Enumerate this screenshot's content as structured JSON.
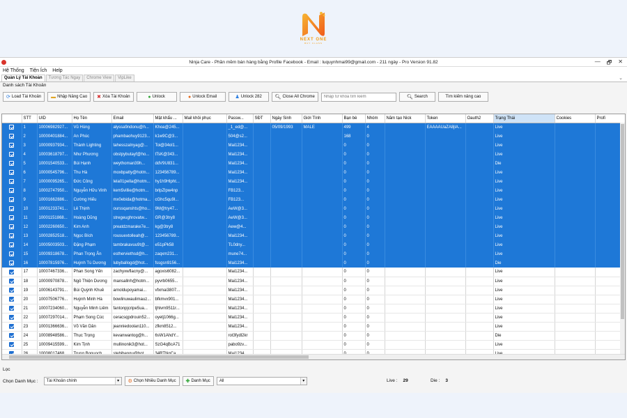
{
  "logo": {
    "brand": "NEXT ONE",
    "tagline": "BUY CLASS",
    "accent": "#f39c12"
  },
  "window": {
    "title": "Ninja Care - Phần mềm bán hàng bằng Profile Facebook - Email : luquynhmai99@gmail.com - 211 ngày - Pro Version 91.82",
    "controls": [
      "—",
      "🗗",
      "✕"
    ]
  },
  "menu": [
    "Hệ Thống",
    "Tiện Ích",
    "Help"
  ],
  "tabs": [
    "Quản Lý Tài Khoản",
    "Tương Tác Ngay",
    "Chrome View",
    "VipLike"
  ],
  "section_label": "Danh sách Tài Khoản",
  "toolbar": {
    "load": "Load Tài Khoản",
    "import": "Nhập Nâng Cao",
    "delete": "Xóa Tài Khoản",
    "unlock": "Unlock",
    "unlock_email": "Unlock Email",
    "unlock282": "Unlock 282",
    "close_chrome": "Close All Chrome",
    "search_placeholder": "Nhập từ khóa tìm kiếm",
    "search": "Search",
    "advanced_search": "Tìm kiếm nâng cao"
  },
  "columns": [
    "",
    "STT",
    "UID",
    "Họ Tên",
    "Email",
    "Mật khẩu ...",
    "Mail khôi phục",
    "Passw...",
    "SĐT",
    "Ngày Sinh",
    "Giới Tính",
    "Bạn bè",
    "Nhóm",
    "Năm tạo Nick",
    "Token",
    "Oauth2",
    "Trạng Thái",
    "Cookies",
    "Profi"
  ],
  "rows": [
    {
      "sel": true,
      "c": [
        "1",
        "10006982927...",
        "Vũ Hùng",
        "alyssa9ndonu@h...",
        "Khoa@245...",
        "",
        "_1_ed@...",
        "",
        "05/09/1993",
        "MALE",
        "499",
        "4",
        "",
        "EAAAAUaZA8jlA...",
        "",
        "Live",
        "",
        ""
      ]
    },
    {
      "sel": true,
      "c": [
        "2",
        "10000401884...",
        "An Phúc",
        "phambaohuy9123...",
        "k1w9C@3...",
        "",
        "504@s2...",
        "",
        "",
        "",
        "168",
        "0",
        "",
        "",
        "",
        "Live",
        "",
        ""
      ]
    },
    {
      "sel": true,
      "c": [
        "3",
        "10000937934...",
        "Thành Lighting",
        "tahesszalnyag@...",
        "Toi@34ol1...",
        "",
        "Mai1234...",
        "",
        "",
        "",
        "0",
        "0",
        "",
        "",
        "",
        "Live",
        "",
        ""
      ]
    },
    {
      "sel": true,
      "c": [
        "4",
        "10003618797...",
        "Như Phương",
        "obstpybutayf@ho...",
        "tTsK@343...",
        "",
        "Mai1234...",
        "",
        "",
        "",
        "0",
        "0",
        "",
        "",
        "",
        "Live",
        "",
        ""
      ]
    },
    {
      "sel": true,
      "c": [
        "5",
        "10001540533...",
        "Bùi Hạnh",
        "weythoman39h...",
        "ddV9U831...",
        "",
        "Mai1234...",
        "",
        "",
        "",
        "0",
        "0",
        "",
        "",
        "",
        "Die",
        "",
        ""
      ]
    },
    {
      "sel": true,
      "c": [
        "6",
        "10000545796...",
        "Thu Hà",
        "moxbpatty@hotm...",
        "123456789...",
        "",
        "Mai1234...",
        "",
        "",
        "",
        "0",
        "0",
        "",
        "",
        "",
        "Live",
        "",
        ""
      ]
    },
    {
      "sel": true,
      "c": [
        "7",
        "10000095265...",
        "Đức Công",
        "lela01pella@hotm...",
        "hy1h9Hlpht...",
        "",
        "Mai1234...",
        "",
        "",
        "",
        "0",
        "0",
        "",
        "",
        "",
        "Live",
        "",
        ""
      ]
    },
    {
      "sel": true,
      "c": [
        "8",
        "10002747950...",
        "Nguyễn Hữu Vinh",
        "kem5villie@hotm...",
        "brlpZlpw4np",
        "",
        "FB123...",
        "",
        "",
        "",
        "0",
        "0",
        "",
        "",
        "",
        "Live",
        "",
        ""
      ]
    },
    {
      "sel": true,
      "c": [
        "9",
        "10001662886...",
        "Cường Hiếu",
        "mx0ebida@hotma...",
        "cGhc5qu9l...",
        "",
        "FB123...",
        "",
        "",
        "",
        "0",
        "0",
        "",
        "",
        "",
        "Live",
        "",
        ""
      ]
    },
    {
      "sel": true,
      "c": [
        "10",
        "10001233741...",
        "Lê Thịnh",
        "ourssqanshts@ho...",
        "9M@try47...",
        "",
        "AeW@3...",
        "",
        "",
        "",
        "0",
        "0",
        "",
        "",
        "",
        "Live",
        "",
        ""
      ]
    },
    {
      "sel": true,
      "c": [
        "11",
        "10001151868...",
        "Hoàng Dũng",
        "stregeughrovatw...",
        "GR@3try8",
        "",
        "AeW@3...",
        "",
        "",
        "",
        "0",
        "0",
        "",
        "",
        "",
        "Live",
        "",
        ""
      ]
    },
    {
      "sel": true,
      "c": [
        "12",
        "10002260650...",
        "Kim Anh",
        "preatdzmarake7e...",
        "kg@3try8",
        "",
        "Aew@4...",
        "",
        "",
        "",
        "0",
        "0",
        "",
        "",
        "",
        "Live",
        "",
        ""
      ]
    },
    {
      "sel": true,
      "c": [
        "13",
        "10002852518...",
        "Ngọc Bích",
        "rousuextolleah@...",
        "123456789...",
        "",
        "Mai1234...",
        "",
        "",
        "",
        "0",
        "0",
        "",
        "",
        "",
        "Live",
        "",
        ""
      ]
    },
    {
      "sel": true,
      "c": [
        "14",
        "10005003503...",
        "Đặng Phạm",
        "tambrakavuu9t@...",
        "e51pPk58",
        "",
        "TL0dny...",
        "",
        "",
        "",
        "0",
        "0",
        "",
        "",
        "",
        "Live",
        "",
        ""
      ]
    },
    {
      "sel": true,
      "c": [
        "15",
        "10009318678...",
        "Phan Trọng Ân",
        "estherviethsd@h...",
        "zaqxm231...",
        "",
        "mune74...",
        "",
        "",
        "",
        "0",
        "0",
        "",
        "",
        "",
        "Live",
        "",
        ""
      ]
    },
    {
      "sel": true,
      "c": [
        "16",
        "10007815976...",
        "Huỳnh Tú Dương",
        "lubyballogd@hot...",
        "fssgsn9156...",
        "",
        "Mai1234...",
        "",
        "",
        "",
        "0",
        "0",
        "",
        "",
        "",
        "Die",
        "",
        ""
      ]
    },
    {
      "sel": false,
      "c": [
        "17",
        "10007467336...",
        "Phan Song Yến",
        "zachyxwflacny@...",
        "agoxis6082...",
        "",
        "Mai1234...",
        "",
        "",
        "",
        "0",
        "0",
        "",
        "",
        "",
        "Live",
        "",
        ""
      ]
    },
    {
      "sel": false,
      "c": [
        "18",
        "10000970878...",
        "Ngô Thiện Dương",
        "mansallnh@hotm...",
        "pyvrb0655...",
        "",
        "Mai1234...",
        "",
        "",
        "",
        "0",
        "0",
        "",
        "",
        "",
        "Live",
        "",
        ""
      ]
    },
    {
      "sel": false,
      "c": [
        "19",
        "10006143791...",
        "Bùi Quỳnh Khuê",
        "arnoldupoyamai...",
        "vfxmai3807...",
        "",
        "Mai1234...",
        "",
        "",
        "",
        "0",
        "0",
        "",
        "",
        "",
        "Live",
        "",
        ""
      ]
    },
    {
      "sel": false,
      "c": [
        "20",
        "10007506776...",
        "Huỳnh Minh Hà",
        "bowlinuwaulimauz...",
        "bfkmvx901...",
        "",
        "Mai1234...",
        "",
        "",
        "",
        "0",
        "0",
        "",
        "",
        "",
        "Live",
        "",
        ""
      ]
    },
    {
      "sel": false,
      "c": [
        "21",
        "10007234060...",
        "Nguyễn Minh Liêm",
        "fantonpjcripe5ua...",
        "tjhlvm9511r...",
        "",
        "Mai1234...",
        "",
        "",
        "",
        "0",
        "0",
        "",
        "",
        "",
        "Live",
        "",
        ""
      ]
    },
    {
      "sel": false,
      "c": [
        "22",
        "10007297014...",
        "Phạm Song Cúc",
        "ceracsqpdrouin52...",
        "oyetj1066g...",
        "",
        "Mai1234...",
        "",
        "",
        "",
        "0",
        "0",
        "",
        "",
        "",
        "Live",
        "",
        ""
      ]
    },
    {
      "sel": false,
      "c": [
        "23",
        "10001366636...",
        "Võ Văn Dân",
        "jeanniedoolan110...",
        "zfkm8512...",
        "",
        "Mai1234...",
        "",
        "",
        "",
        "0",
        "0",
        "",
        "",
        "",
        "Live",
        "",
        ""
      ]
    },
    {
      "sel": false,
      "c": [
        "24",
        "10008948586...",
        "Thục Trọng",
        "kevanwantog@h...",
        "6sW1AhdY...",
        "",
        "rot3fydl2kr",
        "",
        "",
        "",
        "0",
        "0",
        "",
        "",
        "",
        "Die",
        "",
        ""
      ]
    },
    {
      "sel": false,
      "c": [
        "25",
        "10009415599...",
        "Kim Tịnh",
        "mullinonik3@hot...",
        "SzG4qBcA71",
        "",
        "pabo9zv...",
        "",
        "",
        "",
        "0",
        "0",
        "",
        "",
        "",
        "Live",
        "",
        ""
      ]
    },
    {
      "sel": false,
      "c": [
        "26",
        "10008017468...",
        "Trung Bonuoch",
        "stebihengu@hot...",
        "34RTNgCa...",
        "",
        "Mai1234...",
        "",
        "",
        "",
        "0",
        "0",
        "",
        "",
        "",
        "Live",
        "",
        ""
      ]
    }
  ],
  "bottom": {
    "loc_label": "Lọc",
    "category_label": "Chọn Danh Mục :",
    "category_value": "Tài Khoản chính",
    "multi_category": "Chọn Nhiều Danh Mục",
    "add_category": "Danh Mục",
    "filter_value": "All",
    "live_label": "Live :",
    "live_count": "29",
    "die_label": "Die :",
    "die_count": "3"
  },
  "colors": {
    "selected_row": "#1e78d7",
    "accent": "#f39c12"
  }
}
